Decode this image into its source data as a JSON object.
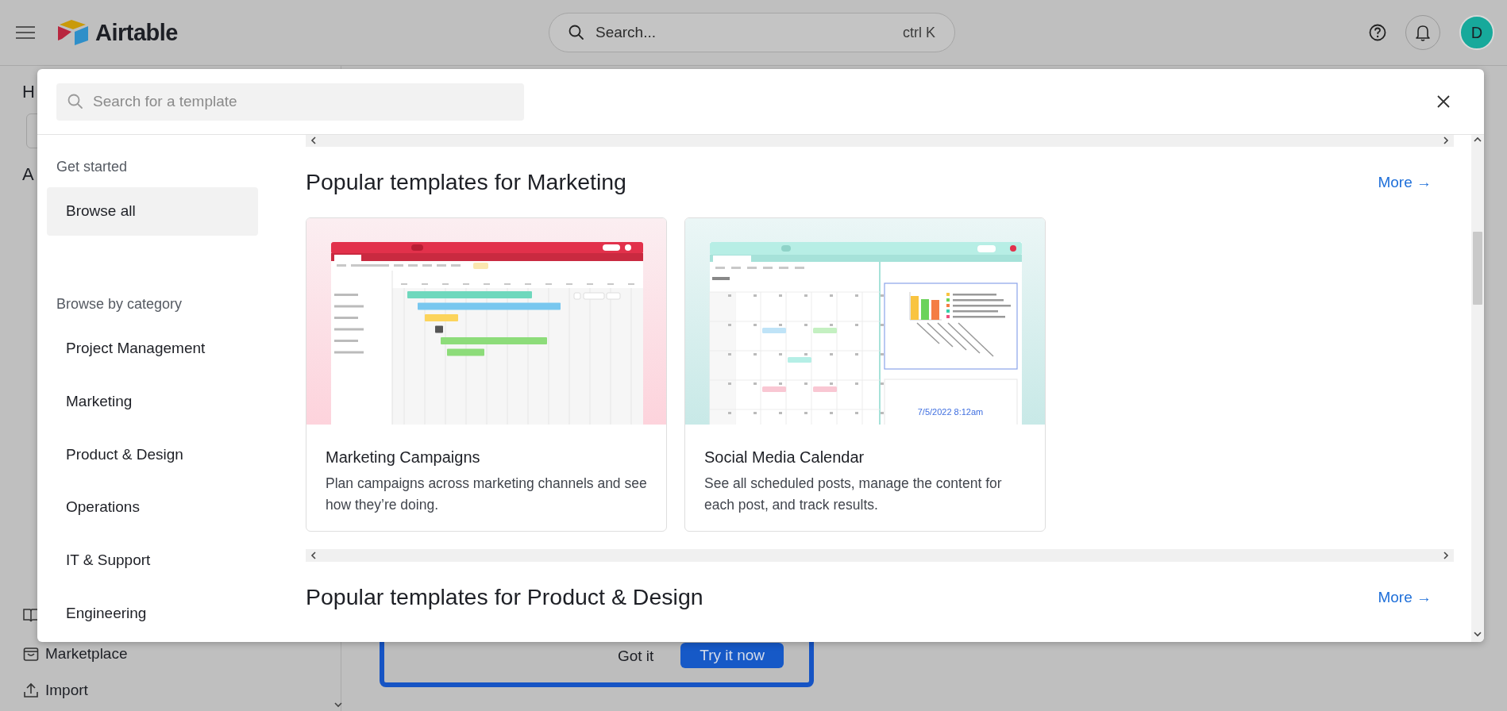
{
  "topbar": {
    "logo": "Airtable",
    "search": {
      "placeholder": "Search...",
      "shortcut": "ctrl K"
    },
    "avatar": "D"
  },
  "background": {
    "sidebar": {
      "heading_fragment": "H",
      "section_fragment": "A",
      "links": [
        {
          "label": "Marketplace",
          "kind": "marketplace"
        },
        {
          "label": "Import",
          "kind": "import"
        }
      ]
    },
    "tip": {
      "dismiss": "Got it",
      "action": "Try it now"
    }
  },
  "modal": {
    "search": {
      "placeholder": "Search for a template"
    },
    "nav": {
      "sections": [
        {
          "title": "Get started",
          "items": [
            {
              "label": "Browse all",
              "selected": true
            }
          ]
        },
        {
          "title": "Browse by category",
          "items": [
            {
              "label": "Project Management",
              "selected": false
            },
            {
              "label": "Marketing",
              "selected": false
            },
            {
              "label": "Product & Design",
              "selected": false
            },
            {
              "label": "Operations",
              "selected": false
            },
            {
              "label": "IT & Support",
              "selected": false
            },
            {
              "label": "Engineering",
              "selected": false
            }
          ]
        }
      ]
    },
    "sections": [
      {
        "title": "Popular templates for Marketing",
        "more": "More →",
        "templates": [
          {
            "name": "Marketing Campaigns",
            "description": "Plan campaigns across marketing channels and see how they’re doing.",
            "kind": "gantt"
          },
          {
            "name": "Social Media Calendar",
            "description": "See all scheduled posts, manage the content for each post, and track results.",
            "kind": "calendar",
            "preview_text": "7/5/2022 8:12am"
          }
        ]
      },
      {
        "title": "Popular templates for Product & Design",
        "more": "More →"
      }
    ]
  }
}
